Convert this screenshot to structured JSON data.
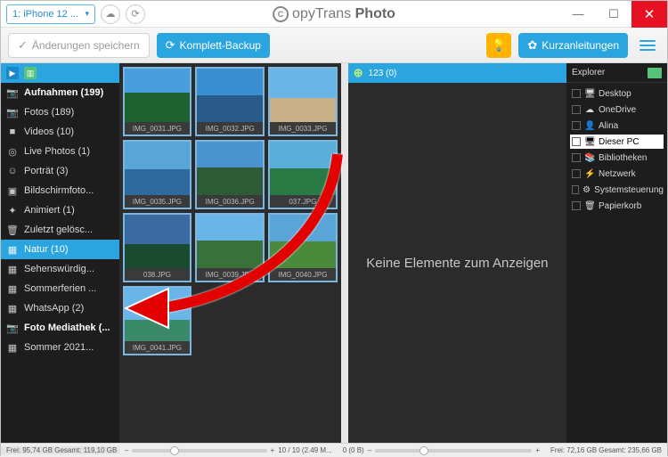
{
  "title": {
    "brand1": "opyTrans",
    "brand2": "Photo",
    "brand_c": "C"
  },
  "device": {
    "label": "1: iPhone 12 ..."
  },
  "toolbar": {
    "save": "Änderungen speichern",
    "backup": "Komplett-Backup",
    "guide": "Kurzanleitungen"
  },
  "sidebar": {
    "items": [
      {
        "icon": "📷",
        "label": "Aufnahmen (199)",
        "bold": true
      },
      {
        "icon": "📷",
        "label": "Fotos (189)"
      },
      {
        "icon": "■",
        "label": "Videos (10)"
      },
      {
        "icon": "◎",
        "label": "Live Photos (1)"
      },
      {
        "icon": "☺",
        "label": "Porträt (3)"
      },
      {
        "icon": "▣",
        "label": "Bildschirmfoto..."
      },
      {
        "icon": "✦",
        "label": "Animiert (1)"
      },
      {
        "icon": "🗑",
        "label": "Zuletzt gelösc..."
      },
      {
        "icon": "▦",
        "label": "Natur (10)",
        "selected": true
      },
      {
        "icon": "▦",
        "label": "Sehenswürdig..."
      },
      {
        "icon": "▦",
        "label": "Sommerferien ..."
      },
      {
        "icon": "▦",
        "label": "WhatsApp (2)"
      },
      {
        "icon": "📷",
        "label": "Foto Mediathek (...",
        "bold": true
      },
      {
        "icon": "▦",
        "label": "Sommer 2021..."
      }
    ]
  },
  "thumbs": [
    "IMG_0031.JPG",
    "IMG_0032.JPG",
    "IMG_0033.JPG",
    "IMG_0035.JPG",
    "IMG_0036.JPG",
    "037.JPG",
    "038.JPG",
    "IMG_0039.JPG",
    "IMG_0040.JPG",
    "IMG_0041.JPG"
  ],
  "right_panel": {
    "strip": "123 (0)",
    "empty": "Keine Elemente zum Anzeigen",
    "status_left": "0 (0 B)"
  },
  "explorer": {
    "title": "Explorer",
    "items": [
      {
        "ic": "🖥",
        "label": "Desktop"
      },
      {
        "ic": "☁",
        "label": "OneDrive"
      },
      {
        "ic": "👤",
        "label": "Alina"
      },
      {
        "ic": "🖥",
        "label": "Dieser PC",
        "selected": true
      },
      {
        "ic": "📚",
        "label": "Bibliotheken"
      },
      {
        "ic": "⚡",
        "label": "Netzwerk"
      },
      {
        "ic": "⚙",
        "label": "Systemsteuerung"
      },
      {
        "ic": "🗑",
        "label": "Papierkorb"
      }
    ]
  },
  "status": {
    "left": "Frei: 95,74 GB Gesamt: 119,10 GB",
    "center_count": "10 / 10 (2.49 M...",
    "explorer": "Frei: 72,16 GB Gesamt: 235,66 GB"
  }
}
